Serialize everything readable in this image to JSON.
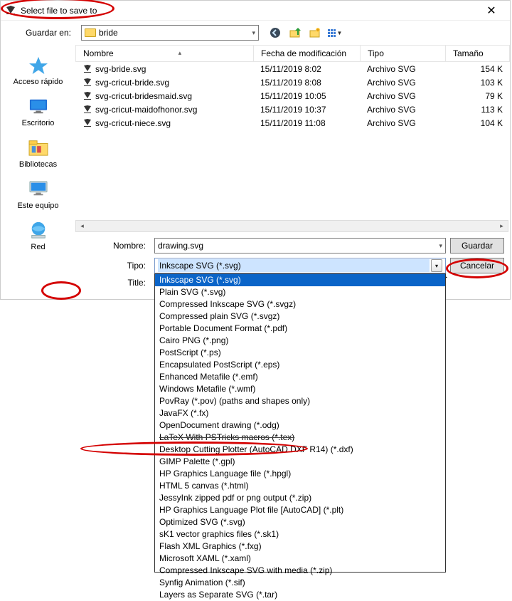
{
  "title": "Select file to save to",
  "save_in_label": "Guardar en:",
  "folder_name": "bride",
  "columns": {
    "name": "Nombre",
    "date": "Fecha de modificación",
    "type": "Tipo",
    "size": "Tamaño"
  },
  "places": [
    {
      "key": "quick",
      "label": "Acceso rápido"
    },
    {
      "key": "desktop",
      "label": "Escritorio"
    },
    {
      "key": "libs",
      "label": "Bibliotecas"
    },
    {
      "key": "thispc",
      "label": "Este equipo"
    },
    {
      "key": "network",
      "label": "Red"
    }
  ],
  "files": [
    {
      "name": "svg-bride.svg",
      "date": "15/11/2019 8:02",
      "type": "Archivo SVG",
      "size": "154 K"
    },
    {
      "name": "svg-cricut-bride.svg",
      "date": "15/11/2019 8:08",
      "type": "Archivo SVG",
      "size": "103 K"
    },
    {
      "name": "svg-cricut-bridesmaid.svg",
      "date": "15/11/2019 10:05",
      "type": "Archivo SVG",
      "size": "79 K"
    },
    {
      "name": "svg-cricut-maidofhonor.svg",
      "date": "15/11/2019 10:37",
      "type": "Archivo SVG",
      "size": "113 K"
    },
    {
      "name": "svg-cricut-niece.svg",
      "date": "15/11/2019 11:08",
      "type": "Archivo SVG",
      "size": "104 K"
    }
  ],
  "form": {
    "name_label": "Nombre:",
    "name_value": "drawing.svg",
    "type_label": "Tipo:",
    "type_selected": "Inkscape SVG (*.svg)",
    "title_label": "Title:",
    "save_button": "Guardar",
    "cancel_button": "Cancelar"
  },
  "type_options": [
    "Inkscape SVG (*.svg)",
    "Plain SVG (*.svg)",
    "Compressed Inkscape SVG (*.svgz)",
    "Compressed plain SVG (*.svgz)",
    "Portable Document Format (*.pdf)",
    "Cairo PNG (*.png)",
    "PostScript (*.ps)",
    "Encapsulated PostScript (*.eps)",
    "Enhanced Metafile (*.emf)",
    "Windows Metafile (*.wmf)",
    "PovRay (*.pov) (paths and shapes only)",
    "JavaFX (*.fx)",
    "OpenDocument drawing (*.odg)",
    "LaTeX With PSTricks macros (*.tex)",
    "Desktop Cutting Plotter (AutoCAD DXF R14) (*.dxf)",
    "GIMP Palette (*.gpl)",
    "HP Graphics Language file (*.hpgl)",
    "HTML 5 canvas (*.html)",
    "JessyInk zipped pdf or png output (*.zip)",
    "HP Graphics Language Plot file [AutoCAD] (*.plt)",
    "Optimized SVG (*.svg)",
    "sK1 vector graphics files (*.sk1)",
    "Flash XML Graphics (*.fxg)",
    "Microsoft XAML (*.xaml)",
    "Compressed Inkscape SVG with media (*.zip)",
    "Synfig Animation (*.sif)",
    "Layers as Separate SVG (*.tar)"
  ]
}
